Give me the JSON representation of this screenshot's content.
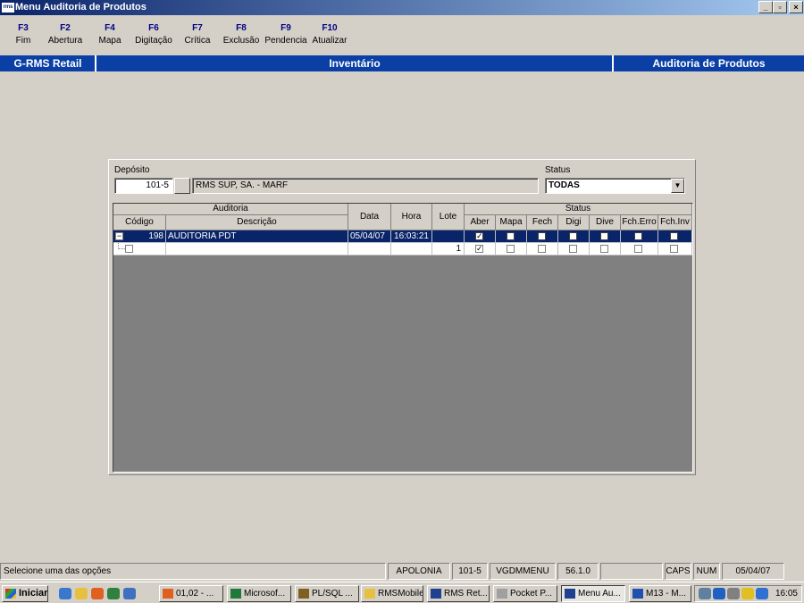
{
  "window": {
    "title": "Menu Auditoria de Produtos",
    "app_icon_text": "rms",
    "minimize": "_",
    "maximize": "▫",
    "close": "×"
  },
  "toolbar": [
    {
      "key": "F3",
      "label": "Fim"
    },
    {
      "key": "F2",
      "label": "Abertura"
    },
    {
      "key": "F4",
      "label": "Mapa"
    },
    {
      "key": "F6",
      "label": "Digitação"
    },
    {
      "key": "F7",
      "label": "Crítica"
    },
    {
      "key": "F8",
      "label": "Exclusão"
    },
    {
      "key": "F9",
      "label": "Pendencia"
    },
    {
      "key": "F10",
      "label": "Atualizar"
    }
  ],
  "header": {
    "left": "G-RMS Retail",
    "center": "Inventário",
    "right": "Auditoria de Produtos"
  },
  "filters": {
    "deposito_label": "Depósito",
    "deposito_code": "101-5",
    "deposito_name": "RMS SUP, SA. - MARF",
    "status_label": "Status",
    "status_value": "TODAS"
  },
  "grid": {
    "group_auditoria": "Auditoria",
    "group_status": "Status",
    "col_codigo": "Código",
    "col_descricao": "Descrição",
    "col_data": "Data",
    "col_hora": "Hora",
    "col_lote": "Lote",
    "status_cols": [
      "Aber",
      "Mapa",
      "Fech",
      "Digi",
      "Dive",
      "Fch.Erro",
      "Fch.Inv"
    ],
    "rows": [
      {
        "codigo": "198",
        "descricao": "AUDITORIA PDT",
        "data": "05/04/07",
        "hora": "16:03:21",
        "lote": "",
        "status": [
          true,
          false,
          false,
          false,
          false,
          false,
          false
        ]
      },
      {
        "codigo": "",
        "descricao": "",
        "data": "",
        "hora": "",
        "lote": "1",
        "status": [
          true,
          false,
          false,
          false,
          false,
          false,
          false
        ]
      }
    ]
  },
  "statusbar": {
    "message": "Selecione uma das opções",
    "panels": [
      "APOLONIA",
      "101-5",
      "VGDMMENU",
      "56.1.0",
      "",
      "CAPS",
      "NUM",
      "05/04/07"
    ]
  },
  "taskbar": {
    "start": "Iniciar",
    "buttons": [
      "01,02 - ...",
      "Microsof...",
      "PL/SQL ...",
      "RMSMobile",
      "RMS Ret...",
      "Pocket P...",
      "Menu Au...",
      "M13 - M..."
    ],
    "clock": "16:05",
    "colors": {
      "title_blue": "#0a246a",
      "band_blue": "#0a3fa6",
      "face": "#d4d0c8",
      "grid_bg": "#808080"
    }
  }
}
